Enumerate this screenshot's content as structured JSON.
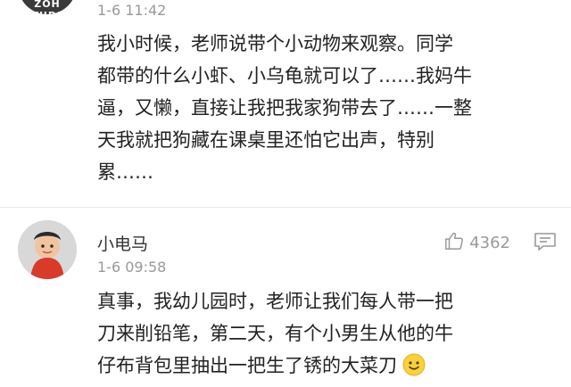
{
  "comments": [
    {
      "avatar_text": "ZOH STUDIO",
      "time": "1-6 11:42",
      "text": "我小时候，老师说带个小动物来观察。同学\n都带的什么小虾、小乌龟就可以了……我妈牛\n逼，又懒，直接让我把我家狗带去了……一整\n天我就把狗藏在课桌里还怕它出声，特别\n累……"
    },
    {
      "name": "小电马",
      "time": "1-6 09:58",
      "likes": "4362",
      "text": "真事，我幼儿园时，老师让我们每人带一把\n刀来削铅笔，第二天，有个小男生从他的牛\n仔布背包里抽出一把生了锈的大菜刀",
      "emoji": "smile-emoji"
    }
  ],
  "icons": {
    "like": "thumbs-up-icon",
    "reply": "comment-icon"
  },
  "colors": {
    "text": "#222222",
    "meta": "#999999",
    "divider": "#e8e8e8"
  }
}
